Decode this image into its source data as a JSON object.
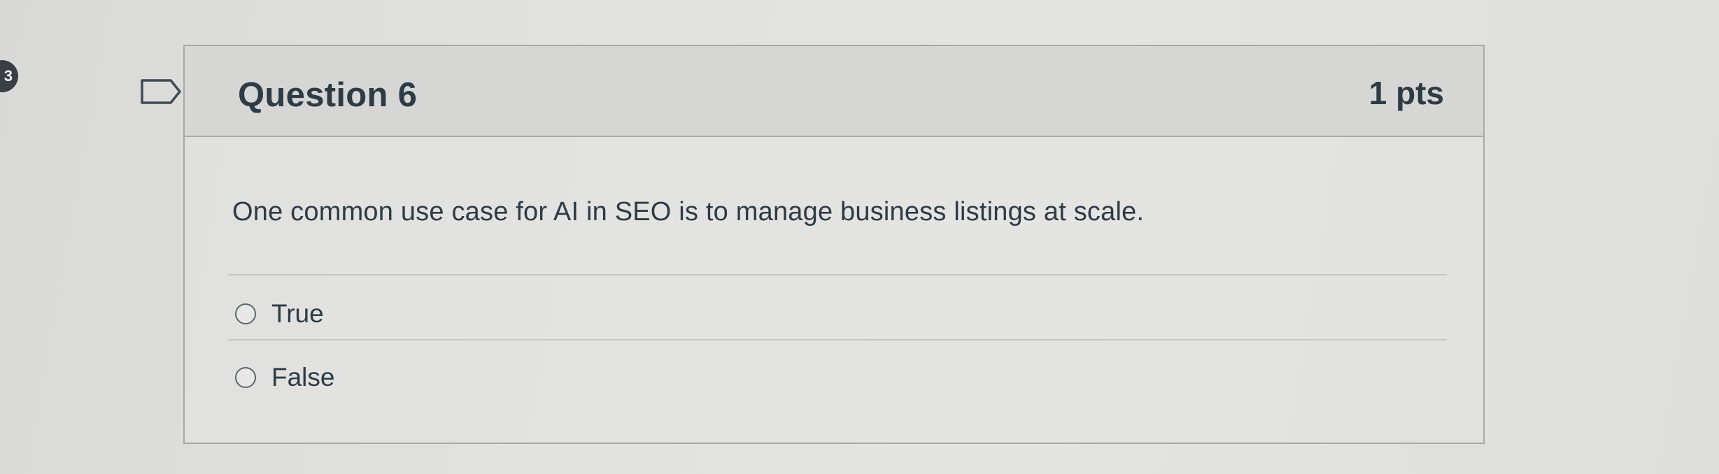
{
  "side_badge": "3",
  "question": {
    "title": "Question 6",
    "points": "1 pts",
    "text": "One common use case for AI in SEO is to manage business listings at scale.",
    "answers": [
      {
        "label": "True",
        "selected": false
      },
      {
        "label": "False",
        "selected": false
      }
    ]
  },
  "icons": {
    "flag": "flag-outline-icon",
    "radio": "radio-unchecked-icon"
  },
  "colors": {
    "text": "#2d3b45",
    "header_bg": "#d6d7d5",
    "border": "#a7a9aa"
  }
}
